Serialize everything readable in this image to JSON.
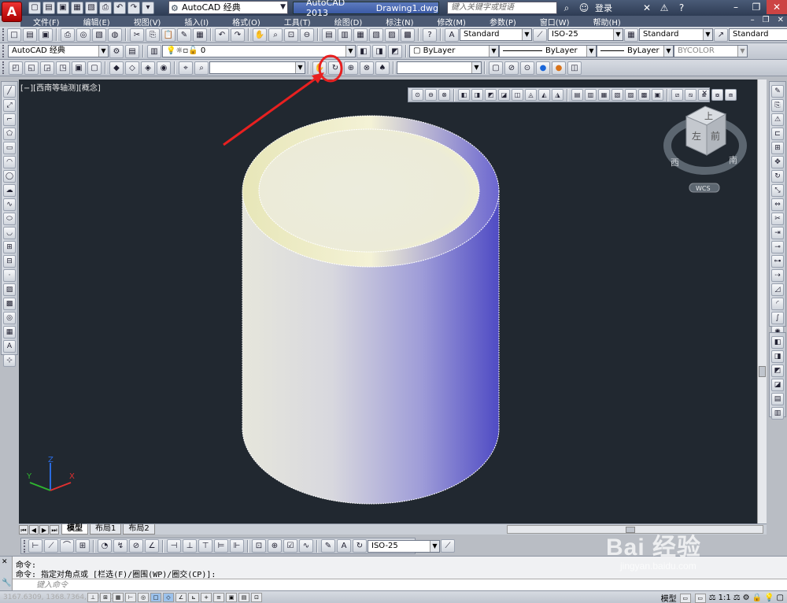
{
  "title_bar": {
    "logo": "A",
    "workspace": "AutoCAD 经典",
    "app_name": "AutoCAD 2013",
    "document": "Drawing1.dwg",
    "search_placeholder": "键入关键字或短语",
    "login": "登录"
  },
  "menu": {
    "items": [
      "文件(F)",
      "编辑(E)",
      "视图(V)",
      "插入(I)",
      "格式(O)",
      "工具(T)",
      "绘图(D)",
      "标注(N)",
      "修改(M)",
      "参数(P)",
      "窗口(W)",
      "帮助(H)"
    ]
  },
  "toolbar1": {
    "text_style": "Standard",
    "dim_style": "ISO-25",
    "table_style": "Standard",
    "mleader_style": "Standard"
  },
  "toolbar2": {
    "workspace": "AutoCAD 经典",
    "layer": "0",
    "color": "ByLayer",
    "linetype": "ByLayer",
    "lineweight": "ByLayer",
    "plotstyle": "BYCOLOR"
  },
  "viewport": {
    "label": "[−][西南等轴测][概念]",
    "viewcube": {
      "top": "上",
      "left": "左",
      "front": "前",
      "south": "南",
      "west": "西",
      "wcs": "WCS"
    },
    "ucs": {
      "x": "X",
      "y": "Y",
      "z": "Z"
    }
  },
  "tabs": [
    "模型",
    "布局1",
    "布局2"
  ],
  "dim_toolbar": {
    "dim_style": "ISO-25"
  },
  "command": {
    "line1": "命令:",
    "line2": "命令: 指定对角点或 [栏选(F)/圈围(WP)/圈交(CP)]:",
    "input_placeholder": "键入命令"
  },
  "status": {
    "coords": "3167.6309, 1368.7364, 0.0000",
    "model": "模型",
    "scale": "1:1"
  },
  "watermark": {
    "brand": "Bai 经验",
    "url": "jingyan.baidu.com"
  },
  "colors": {
    "accent": "#e82020",
    "viewport_bg": "#212830",
    "title_bg": "#3b4a64"
  }
}
